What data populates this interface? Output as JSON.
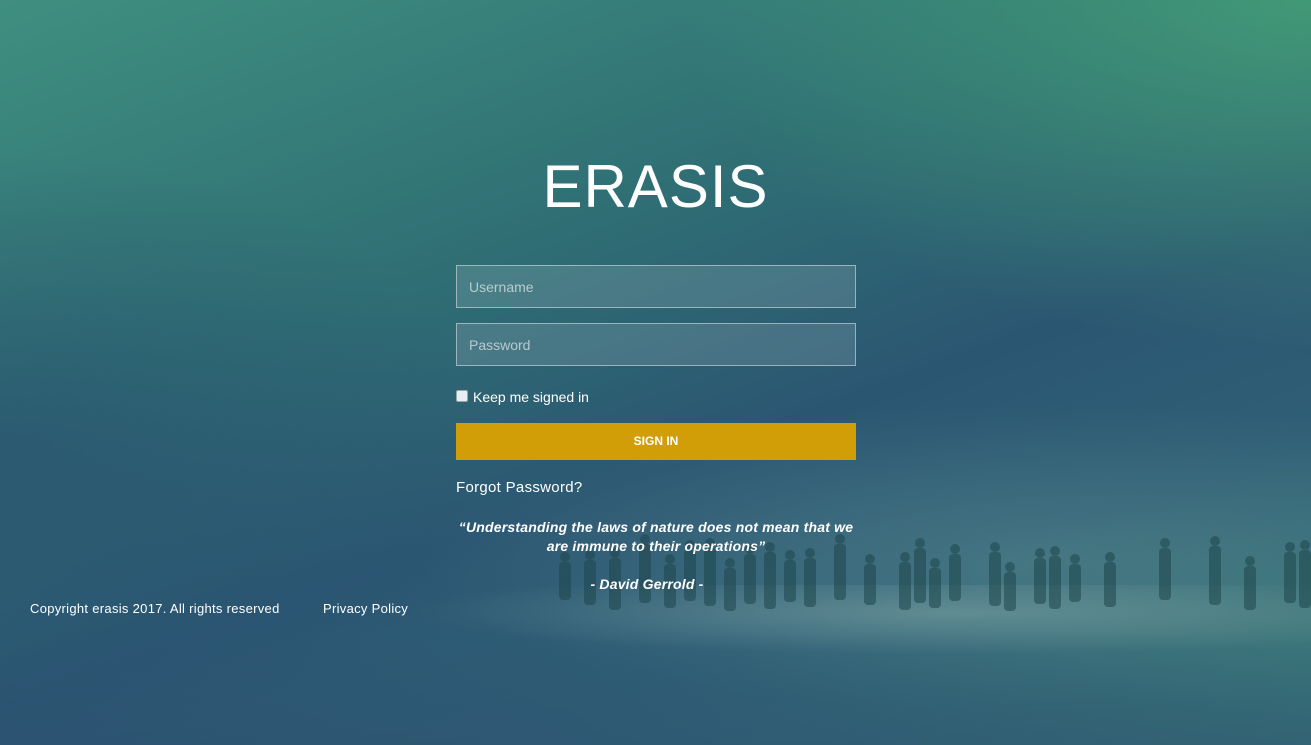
{
  "brand": {
    "title": "ERASIS"
  },
  "login": {
    "username_placeholder": "Username",
    "password_placeholder": "Password",
    "remember_label": "Keep me signed in",
    "signin_label": "SIGN IN",
    "forgot_label": "Forgot Password?"
  },
  "quote": {
    "text": "“Understanding the laws of nature does not mean that we are immune to their operations”",
    "author": "-   David Gerrold   -"
  },
  "footer": {
    "copyright": "Copyright erasis 2017. All rights reserved",
    "privacy": "Privacy Policy"
  },
  "colors": {
    "accent_button": "#d19e08",
    "background_top_right": "#3f9a78",
    "background_left": "#2b4f72"
  }
}
